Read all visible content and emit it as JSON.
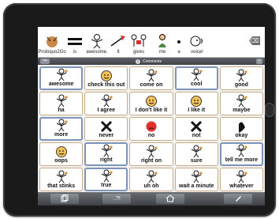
{
  "message_bar": {
    "tokens": [
      {
        "label": "Proloquo2Go",
        "icon": "logo-icon"
      },
      {
        "label": "is",
        "icon": "equals-icon"
      },
      {
        "label": "awesome.",
        "icon": "person-icon"
      },
      {
        "label": "It",
        "icon": "pointing-icon"
      },
      {
        "label": "gives",
        "icon": "gives-icon"
      },
      {
        "label": "me",
        "icon": "person-icon"
      },
      {
        "label": "a",
        "icon": "dot-icon"
      },
      {
        "label": "voice!",
        "icon": "speech-icon"
      }
    ],
    "delete_icon": "backspace-icon",
    "delete_label": "⌫"
  },
  "page_bar": {
    "left_label": "•••",
    "title": "Comments",
    "center_icon": "i",
    "right_label": "+"
  },
  "grid": {
    "cells": [
      {
        "label": "awesome",
        "icon": "person-icon",
        "style": "blue"
      },
      {
        "label": "check this out",
        "icon": "face-icon",
        "style": "plain"
      },
      {
        "label": "come on",
        "icon": "person-icon",
        "style": "plain"
      },
      {
        "label": "cool",
        "icon": "person-icon",
        "style": "blue"
      },
      {
        "label": "good",
        "icon": "person-icon",
        "style": "plain"
      },
      {
        "label": "ha",
        "icon": "person-icon",
        "style": "plain"
      },
      {
        "label": "I agree",
        "icon": "person-icon",
        "style": "plain"
      },
      {
        "label": "I don't like it",
        "icon": "face-icon",
        "style": "plain"
      },
      {
        "label": "I like it",
        "icon": "face-icon",
        "style": "plain"
      },
      {
        "label": "maybe",
        "icon": "person-icon",
        "style": "plain"
      },
      {
        "label": "more",
        "icon": "person-icon",
        "style": "blue"
      },
      {
        "label": "never",
        "icon": "x-icon",
        "style": "plain"
      },
      {
        "label": "no",
        "icon": "red-face-icon",
        "style": "plain"
      },
      {
        "label": "not",
        "icon": "x-icon",
        "style": "plain"
      },
      {
        "label": "okay",
        "icon": "hand-icon",
        "style": "plain"
      },
      {
        "label": "oops",
        "icon": "face-icon",
        "style": "plain"
      },
      {
        "label": "right",
        "icon": "person-icon",
        "style": "blue"
      },
      {
        "label": "right on",
        "icon": "person-icon",
        "style": "plain"
      },
      {
        "label": "sure",
        "icon": "person-icon",
        "style": "plain"
      },
      {
        "label": "tell me more",
        "icon": "person-icon",
        "style": "blue"
      },
      {
        "label": "that stinks",
        "icon": "person-icon",
        "style": "plain"
      },
      {
        "label": "true",
        "icon": "person-icon",
        "style": "blue"
      },
      {
        "label": "uh oh",
        "icon": "person-icon",
        "style": "plain"
      },
      {
        "label": "wait a minute",
        "icon": "person-icon",
        "style": "plain"
      },
      {
        "label": "whatever",
        "icon": "person-icon",
        "style": "plain"
      }
    ]
  },
  "toolbar": {
    "buttons": [
      {
        "label": "",
        "icon": "pages-icon"
      },
      {
        "label": "..?!",
        "icon": "punctuation-icon"
      },
      {
        "label": "",
        "icon": "home-icon"
      },
      {
        "label": "",
        "icon": "pencil-icon"
      }
    ]
  }
}
